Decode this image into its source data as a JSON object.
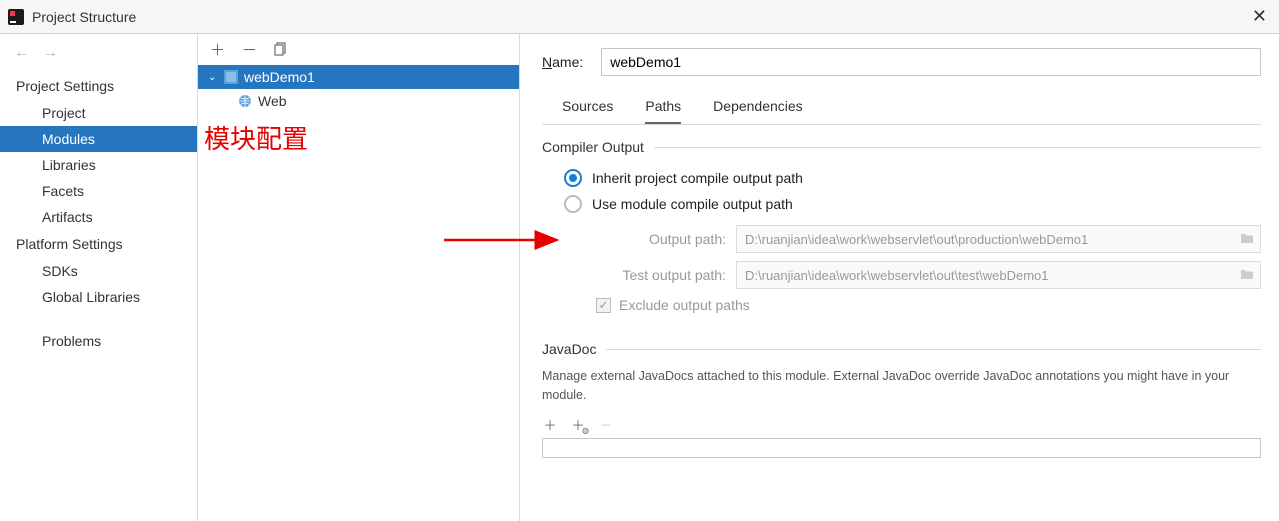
{
  "window": {
    "title": "Project Structure"
  },
  "sidebar": {
    "sections": [
      {
        "header": "Project Settings",
        "items": [
          "Project",
          "Modules",
          "Libraries",
          "Facets",
          "Artifacts"
        ],
        "selectedIndex": 1
      },
      {
        "header": "Platform Settings",
        "items": [
          "SDKs",
          "Global Libraries"
        ]
      }
    ],
    "lower": [
      "Problems"
    ]
  },
  "tree": {
    "root": {
      "label": "webDemo1",
      "expanded": true
    },
    "children": [
      {
        "label": "Web"
      }
    ]
  },
  "annotation": {
    "text": "模块配置"
  },
  "main": {
    "nameLabel": "Name:",
    "nameValue": "webDemo1",
    "tabs": [
      "Sources",
      "Paths",
      "Dependencies"
    ],
    "activeTab": 1,
    "compilerOutput": {
      "header": "Compiler Output",
      "options": [
        "Inherit project compile output path",
        "Use module compile output path"
      ],
      "selected": 0,
      "outputPathLabel": "Output path:",
      "outputPathValue": "D:\\ruanjian\\idea\\work\\webservlet\\out\\production\\webDemo1",
      "testOutputPathLabel": "Test output path:",
      "testOutputPathValue": "D:\\ruanjian\\idea\\work\\webservlet\\out\\test\\webDemo1",
      "excludeLabel": "Exclude output paths",
      "excludeChecked": true
    },
    "javadoc": {
      "header": "JavaDoc",
      "desc": "Manage external JavaDocs attached to this module. External JavaDoc override JavaDoc annotations you might have in your module."
    }
  }
}
